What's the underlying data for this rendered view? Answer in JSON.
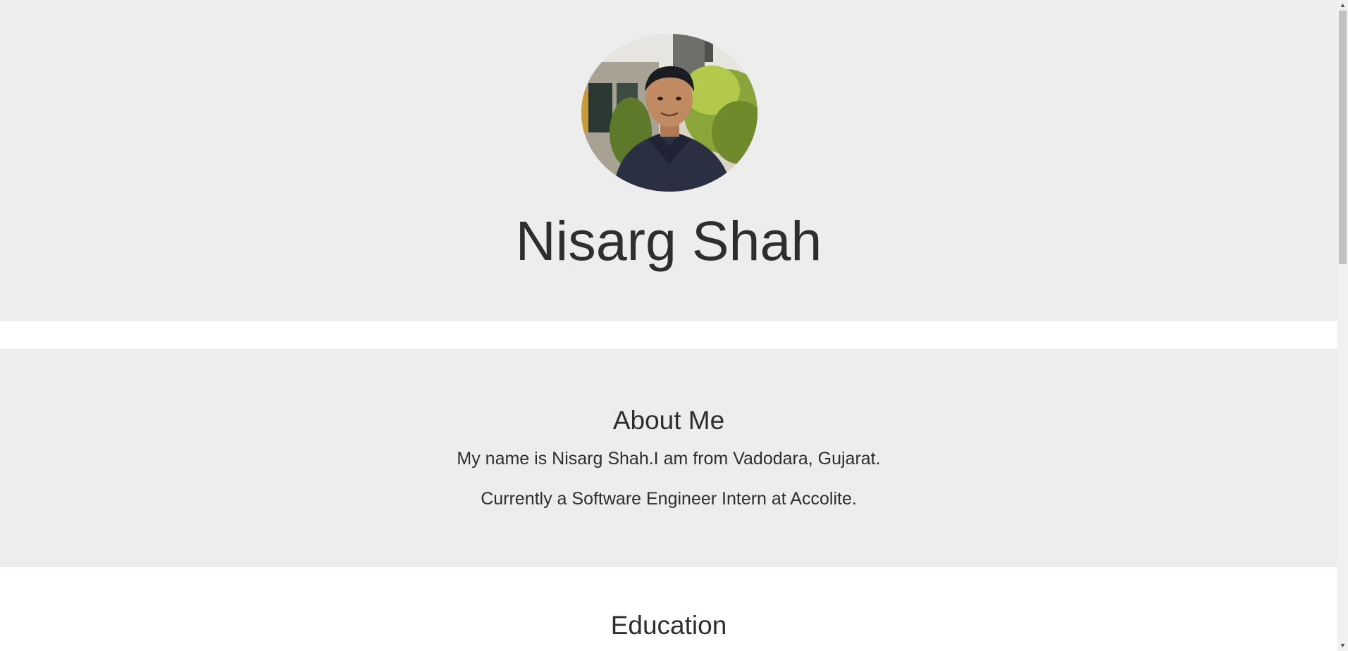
{
  "profile": {
    "name": "Nisarg Shah",
    "avatar_alt": "Profile photo of Nisarg Shah"
  },
  "about": {
    "heading": "About Me",
    "line1": "My name is Nisarg Shah.I am from Vadodara, Gujarat.",
    "line2": "Currently a Software Engineer Intern at Accolite."
  },
  "education": {
    "heading": "Education"
  },
  "scrollbar": {
    "up_icon": "▲",
    "down_icon": "▼",
    "position": 0
  },
  "colors": {
    "section_bg": "#ededed",
    "page_bg": "#ffffff",
    "text": "#2e2e2e"
  }
}
